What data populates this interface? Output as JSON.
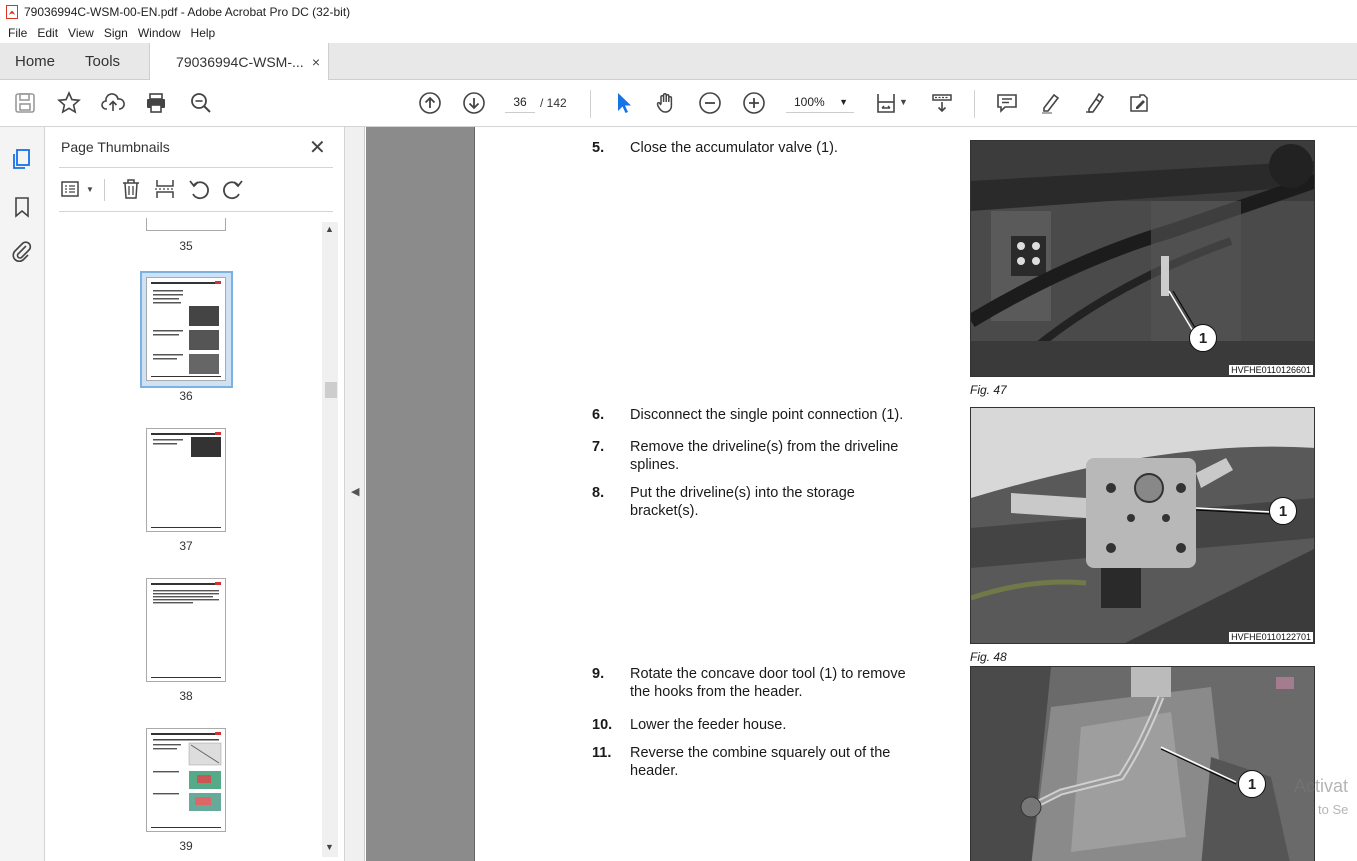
{
  "window": {
    "title": "79036994C-WSM-00-EN.pdf - Adobe Acrobat Pro DC (32-bit)"
  },
  "menu": [
    "File",
    "Edit",
    "View",
    "Sign",
    "Window",
    "Help"
  ],
  "tabs": {
    "home": "Home",
    "tools": "Tools",
    "document": "79036994C-WSM-...",
    "close": "×"
  },
  "toolbar": {
    "current_page": "36",
    "page_total": "/ 142",
    "zoom": "100%"
  },
  "thumbnails": {
    "title": "Page Thumbnails",
    "close": "✕",
    "pages": [
      "35",
      "36",
      "37",
      "38",
      "39"
    ],
    "selected": "36"
  },
  "document": {
    "steps": [
      {
        "num": "5.",
        "text": "Close the accumulator valve (1)."
      },
      {
        "num": "6.",
        "text": "Disconnect the single point connection (1)."
      },
      {
        "num": "7.",
        "text": "Remove the driveline(s) from the driveline splines."
      },
      {
        "num": "8.",
        "text": "Put the driveline(s) into the storage bracket(s)."
      },
      {
        "num": "9.",
        "text": "Rotate the concave door tool (1) to remove the hooks from the header."
      },
      {
        "num": "10.",
        "text": "Lower the feeder house."
      },
      {
        "num": "11.",
        "text": "Reverse the combine squarely out of the header."
      }
    ],
    "figures": [
      {
        "code": "HVFHE0110126601",
        "caption": "Fig. 47",
        "callout": "1"
      },
      {
        "code": "HVFHE0110122701",
        "caption": "Fig. 48",
        "callout": "1"
      },
      {
        "code": "",
        "caption": "",
        "callout": "1"
      }
    ]
  },
  "watermark": {
    "line1": "Activat",
    "line2": "to Se"
  }
}
